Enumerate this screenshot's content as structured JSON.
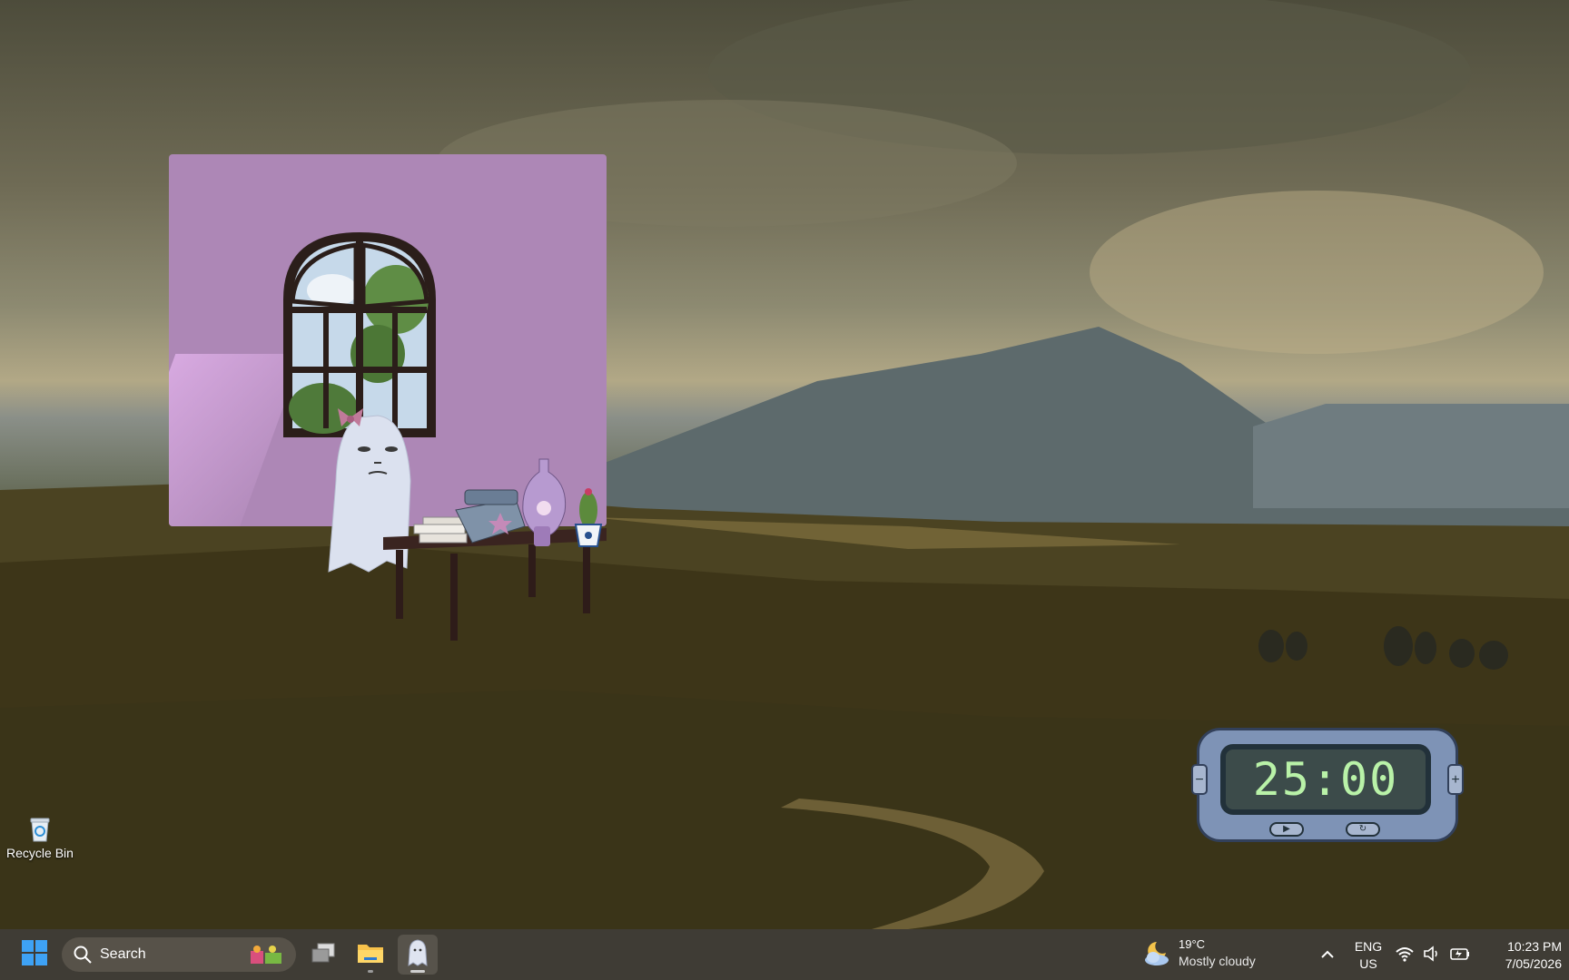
{
  "desktop": {
    "icons": [
      {
        "label": "Recycle Bin",
        "icon": "recycle-bin-icon"
      }
    ]
  },
  "widgets": {
    "ghost_room": {
      "scene": [
        "window-with-tree",
        "ghost-with-bow",
        "desk",
        "typewriter",
        "books",
        "vase",
        "potted-cactus"
      ],
      "wall_color": "#ad87b6"
    },
    "pomodoro_timer": {
      "display": "25:00",
      "buttons": {
        "decrease": "−",
        "increase": "+",
        "play": "▶",
        "reset": "↻"
      },
      "screen_text_color": "#b9f2a8"
    }
  },
  "taskbar": {
    "search": {
      "placeholder": "Search"
    },
    "pinned": [
      {
        "name": "task-view",
        "icon": "task-view-icon"
      },
      {
        "name": "file-explorer",
        "icon": "folder-icon"
      },
      {
        "name": "ghost-app",
        "icon": "ghost-icon",
        "active": true
      }
    ],
    "weather": {
      "temperature": "19°C",
      "condition": "Mostly cloudy",
      "icon": "partly-cloudy-night-icon"
    },
    "language": {
      "line1": "ENG",
      "line2": "US"
    },
    "tray_icons": [
      "wifi-icon",
      "volume-icon",
      "battery-icon"
    ],
    "clock": {
      "time": "10:23 PM",
      "date": "7/05/2026"
    }
  }
}
